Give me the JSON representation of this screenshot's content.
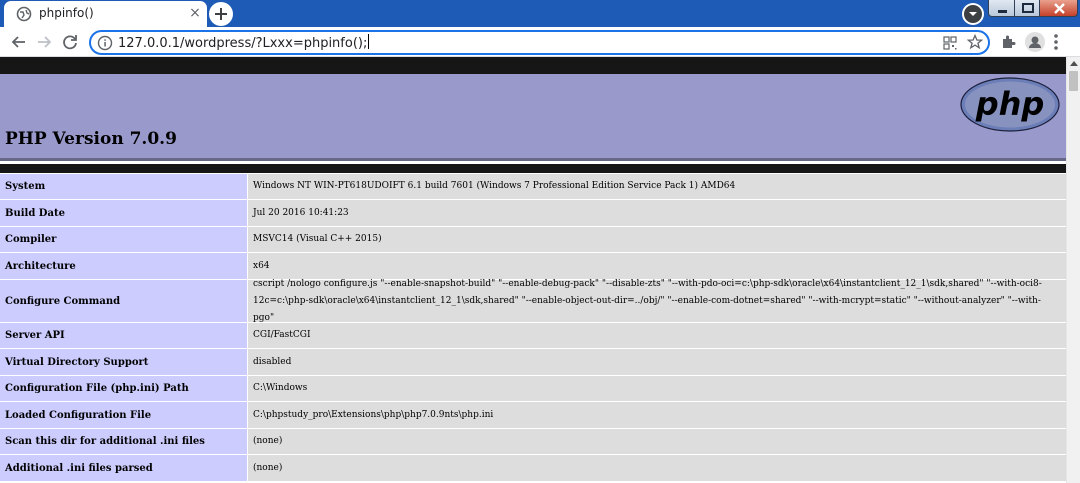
{
  "browser": {
    "tab": {
      "title": "phpinfo()",
      "close_symbol": "×",
      "icon": "globe-icon"
    },
    "new_tab_icon": "plus-icon",
    "address_bar": {
      "url": "127.0.0.1/wordpress/?Lxxx=phpinfo();",
      "info_icon": "info-icon"
    },
    "toolbar_icons": [
      "back-icon",
      "forward-icon",
      "reload-icon",
      "qr-code-icon",
      "star-icon",
      "extensions-icon",
      "account-icon",
      "menu-icon"
    ],
    "colors": {
      "tabstrip": "#1e5bb7",
      "omnibox_border": "#1a73e8"
    }
  },
  "page": {
    "title": "PHP Version 7.0.9",
    "logo_text": "php",
    "colors": {
      "header": "#9999cc",
      "label_cell": "#ccccff",
      "value_cell": "#dddddd",
      "logo": "#6c7eb7"
    },
    "rows": [
      {
        "label": "System",
        "value": "Windows NT WIN-PT618UDOIFT 6.1 build 7601 (Windows 7 Professional Edition Service Pack 1) AMD64"
      },
      {
        "label": "Build Date",
        "value": "Jul 20 2016 10:41:23"
      },
      {
        "label": "Compiler",
        "value": "MSVC14 (Visual C++ 2015)"
      },
      {
        "label": "Architecture",
        "value": "x64"
      },
      {
        "label": "Configure Command",
        "value": "cscript /nologo configure.js \"--enable-snapshot-build\" \"--enable-debug-pack\" \"--disable-zts\" \"--with-pdo-oci=c:\\php-sdk\\oracle\\x64\\instantclient_12_1\\sdk,shared\" \"--with-oci8-12c=c:\\php-sdk\\oracle\\x64\\instantclient_12_1\\sdk,shared\" \"--enable-object-out-dir=../obj/\" \"--enable-com-dotnet=shared\" \"--with-mcrypt=static\" \"--without-analyzer\" \"--with-pgo\""
      },
      {
        "label": "Server API",
        "value": "CGI/FastCGI"
      },
      {
        "label": "Virtual Directory Support",
        "value": "disabled"
      },
      {
        "label": "Configuration File (php.ini) Path",
        "value": "C:\\Windows"
      },
      {
        "label": "Loaded Configuration File",
        "value": "C:\\phpstudy_pro\\Extensions\\php\\php7.0.9nts\\php.ini"
      },
      {
        "label": "Scan this dir for additional .ini files",
        "value": "(none)"
      },
      {
        "label": "Additional .ini files parsed",
        "value": "(none)"
      }
    ]
  }
}
